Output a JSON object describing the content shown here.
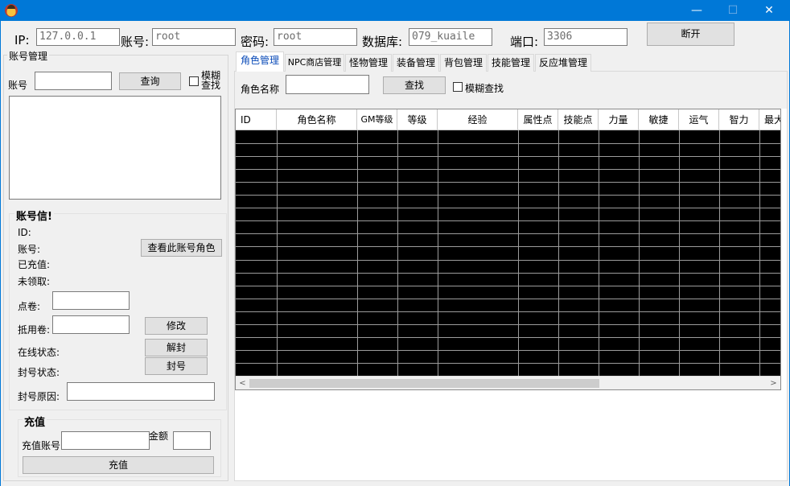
{
  "window": {
    "title": "",
    "minimize": "—",
    "maximize": "☐",
    "close": "✕"
  },
  "connection": {
    "ip_label": "IP:",
    "ip_value": "127.0.0.1",
    "user_label": "账号:",
    "user_value": "root",
    "pass_label": "密码:",
    "pass_value": "root",
    "db_label": "数据库:",
    "db_value": "079_kuaile",
    "port_label": "端口:",
    "port_value": "3306",
    "disconnect_label": "断开"
  },
  "account": {
    "group_title": "账号管理",
    "account_label": "账号",
    "query_label": "查询",
    "fuzzy_label_1": "模糊",
    "fuzzy_label_2": "查找",
    "info_title": "账号信!",
    "id_label": "ID:",
    "acct_label": "账号:",
    "recharged_label": "已充值:",
    "unclaimed_label": "未领取:",
    "view_roles_label": "查看此账号角色",
    "points_label": "点卷:",
    "voucher_label": "抵用卷:",
    "modify_label": "修改",
    "online_label": "在线状态:",
    "unban_label": "解封",
    "ban_status_label": "封号状态:",
    "ban_label": "封号",
    "ban_reason_label": "封号原因:"
  },
  "recharge": {
    "title": "充值",
    "account_label": "充值账号",
    "amount_label": "金额",
    "button_label": "充值"
  },
  "tabs": [
    {
      "label": "角色管理",
      "active": true
    },
    {
      "label": "NPC商店管理"
    },
    {
      "label": "怪物管理"
    },
    {
      "label": "装备管理"
    },
    {
      "label": "背包管理"
    },
    {
      "label": "技能管理"
    },
    {
      "label": "反应堆管理"
    }
  ],
  "role_panel": {
    "name_label": "角色名称",
    "find_label": "查找",
    "fuzzy_label": "模糊查找"
  },
  "grid": {
    "columns": [
      "ID",
      "角色名称",
      "GM等级",
      "等级",
      "经验",
      "属性点",
      "技能点",
      "力量",
      "敏捷",
      "运气",
      "智力",
      "最大"
    ],
    "row_count": 19,
    "scroll_left": "<",
    "scroll_right": ">"
  },
  "colors": {
    "titlebar": "#0078d7",
    "active_tab_text": "#0a4bb8",
    "grid_body": "#000000"
  }
}
